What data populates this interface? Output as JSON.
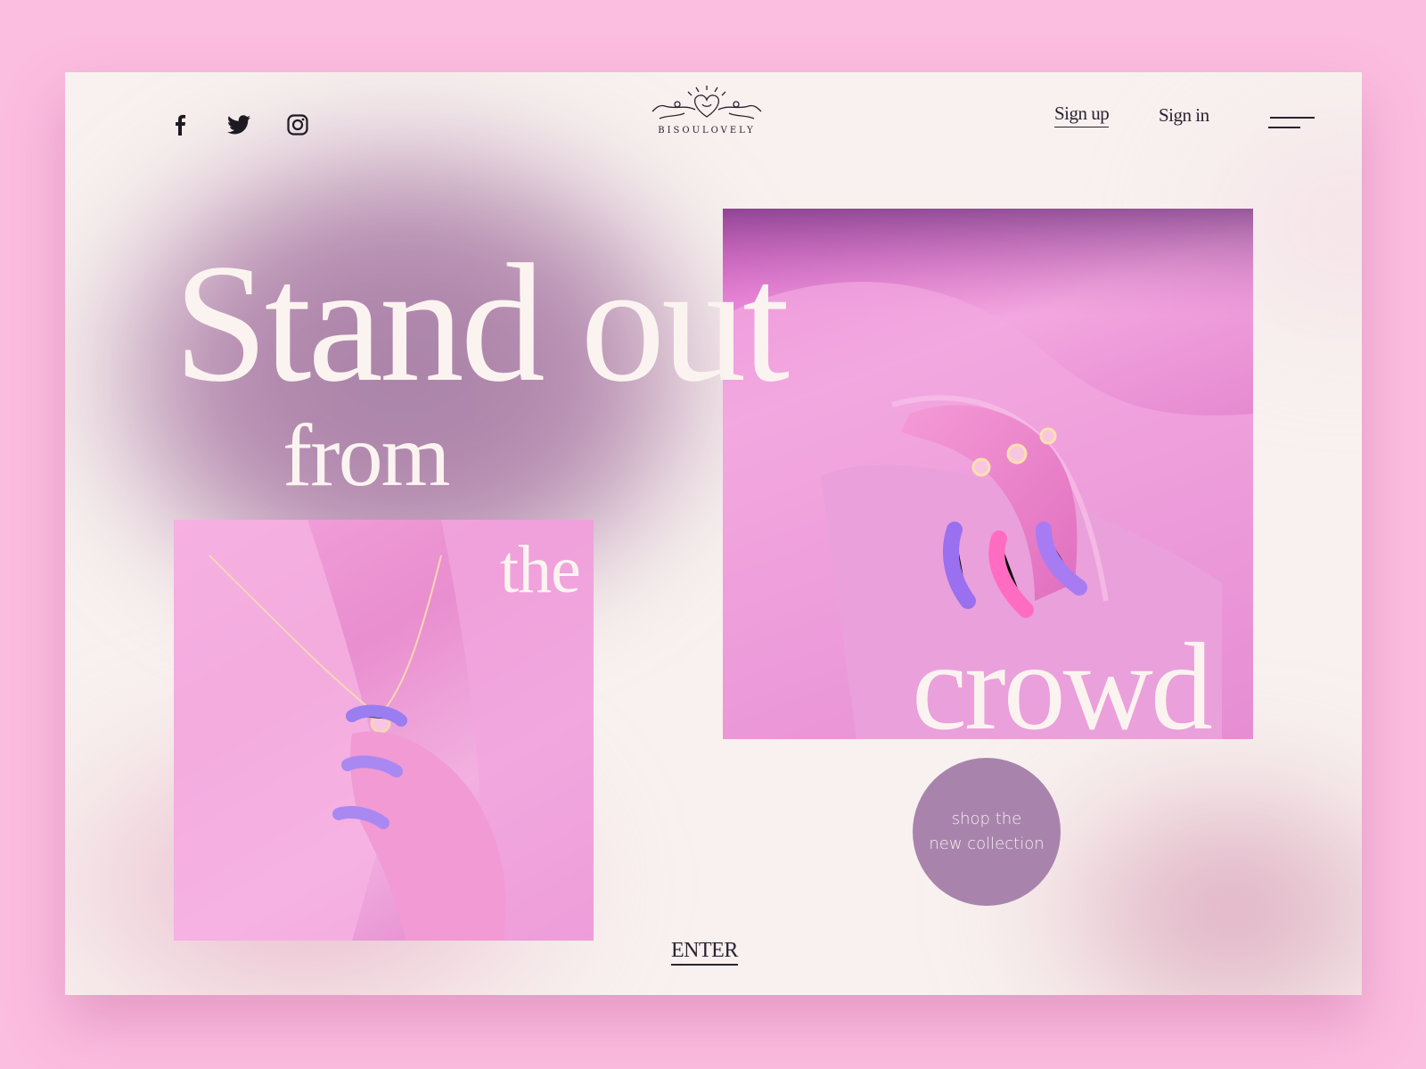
{
  "brand": {
    "name": "BISOULOVELY"
  },
  "header": {
    "social": [
      {
        "icon": "facebook-icon"
      },
      {
        "icon": "twitter-icon"
      },
      {
        "icon": "instagram-icon"
      }
    ],
    "signup_label": "Sign up",
    "signin_label": "Sign in",
    "menu_icon": "menu-icon"
  },
  "hero": {
    "line1": "Stand out",
    "line2": "from",
    "line3": "the",
    "line4": "crowd",
    "cta_line1": "shop the",
    "cta_line2": "new collection",
    "enter_label": "ENTER"
  },
  "colors": {
    "page_bg": "#fbbde0",
    "card_bg": "#f8f1ef",
    "accent_circle": "#a884ac",
    "headline": "#fbf3f0",
    "text_dark": "#2a2230"
  }
}
